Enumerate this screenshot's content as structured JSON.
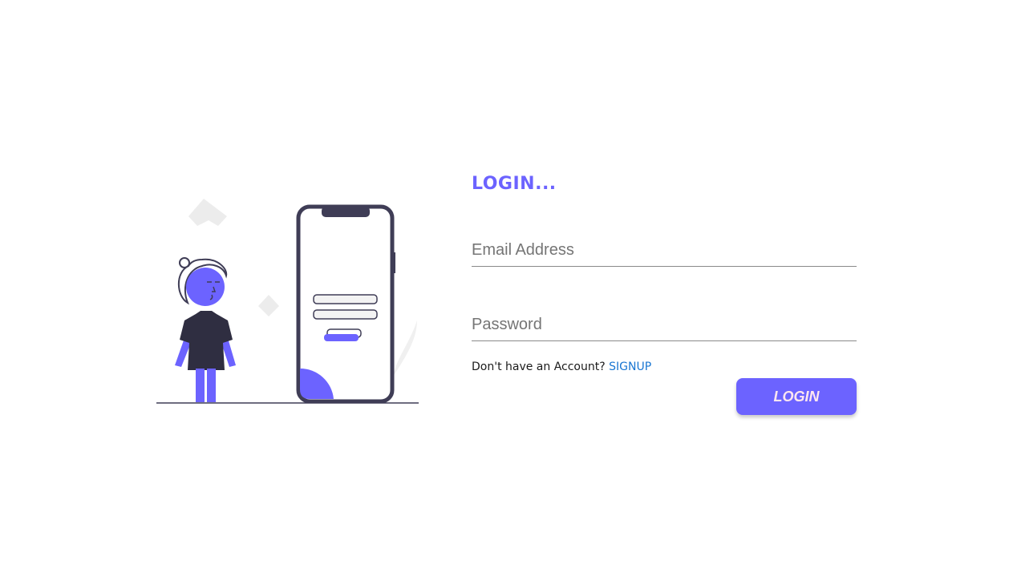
{
  "colors": {
    "accent": "#6c63ff",
    "dark": "#3f3d56",
    "link": "#1976d2",
    "text": "#1a1a1a"
  },
  "form": {
    "title": "LOGIN...",
    "email": {
      "placeholder": "Email Address",
      "value": ""
    },
    "password": {
      "placeholder": "Password",
      "value": ""
    },
    "signup_prompt": "Don't have an Account?",
    "signup_link": "SIGNUP",
    "login_button": "LOGIN"
  },
  "illustration": {
    "icon": "person-with-phone-login-illustration"
  }
}
